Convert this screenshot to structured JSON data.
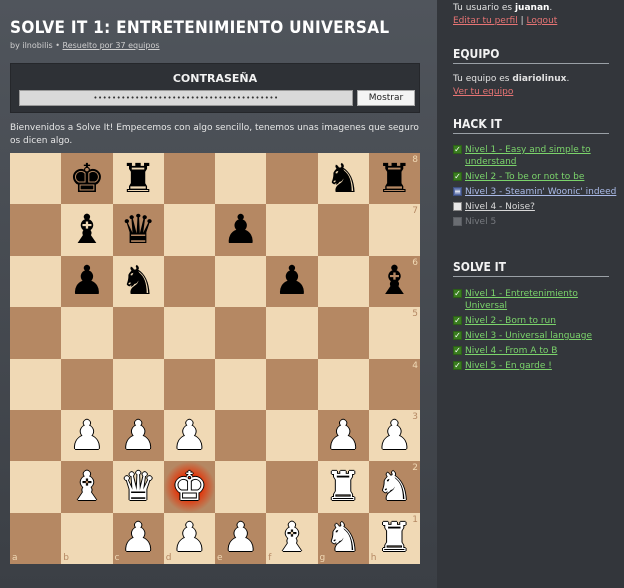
{
  "page": {
    "title": "Solve it 1: Entretenimiento universal",
    "byline_author": "by ilnobilis",
    "byline_sep": " • ",
    "byline_solved": "Resuelto por 37 equipos",
    "password_label": "CONTRASEÑA",
    "password_value": "••••••••••••••••••••••••••••••••••••••••",
    "show_button": "Mostrar",
    "intro": "Bienvenidos a Solve It! Empecemos con algo sencillo, tenemos unas imagenes que seguro os dicen algo."
  },
  "board": {
    "files": [
      "a",
      "b",
      "c",
      "d",
      "e",
      "f",
      "g",
      "h"
    ],
    "ranks": [
      "8",
      "7",
      "6",
      "5",
      "4",
      "3",
      "2",
      "1"
    ],
    "check_square": "d2",
    "pieces": [
      {
        "sq": "b8",
        "glyph": "♚",
        "color": "b"
      },
      {
        "sq": "c8",
        "glyph": "♜",
        "color": "b"
      },
      {
        "sq": "g8",
        "glyph": "♞",
        "color": "b"
      },
      {
        "sq": "h8",
        "glyph": "♜",
        "color": "b"
      },
      {
        "sq": "b7",
        "glyph": "♝",
        "color": "b"
      },
      {
        "sq": "c7",
        "glyph": "♛",
        "color": "b"
      },
      {
        "sq": "e7",
        "glyph": "♟",
        "color": "b"
      },
      {
        "sq": "b6",
        "glyph": "♟",
        "color": "b"
      },
      {
        "sq": "c6",
        "glyph": "♞",
        "color": "b"
      },
      {
        "sq": "f6",
        "glyph": "♟",
        "color": "b"
      },
      {
        "sq": "h6",
        "glyph": "♝",
        "color": "b"
      },
      {
        "sq": "b3",
        "glyph": "♟",
        "color": "w"
      },
      {
        "sq": "c3",
        "glyph": "♟",
        "color": "w"
      },
      {
        "sq": "d3",
        "glyph": "♟",
        "color": "w"
      },
      {
        "sq": "g3",
        "glyph": "♟",
        "color": "w"
      },
      {
        "sq": "h3",
        "glyph": "♟",
        "color": "w"
      },
      {
        "sq": "b2",
        "glyph": "♝",
        "color": "w"
      },
      {
        "sq": "c2",
        "glyph": "♛",
        "color": "w"
      },
      {
        "sq": "d2",
        "glyph": "♚",
        "color": "w"
      },
      {
        "sq": "g2",
        "glyph": "♜",
        "color": "w"
      },
      {
        "sq": "h2",
        "glyph": "♞",
        "color": "w"
      },
      {
        "sq": "c1",
        "glyph": "♟",
        "color": "w"
      },
      {
        "sq": "d1",
        "glyph": "♟",
        "color": "w"
      },
      {
        "sq": "e1",
        "glyph": "♟",
        "color": "w"
      },
      {
        "sq": "f1",
        "glyph": "♝",
        "color": "w"
      },
      {
        "sq": "g1",
        "glyph": "♞",
        "color": "w"
      },
      {
        "sq": "h1",
        "glyph": "♜",
        "color": "w"
      }
    ]
  },
  "sidebar": {
    "user_prefix": "Tu usuario es ",
    "user_name": "juanan",
    "user_suffix": ".",
    "edit_profile": "Editar tu perfil",
    "sep": " | ",
    "logout": "Logout",
    "equipo_heading": "EQUIPO",
    "team_prefix": "Tu equipo es ",
    "team_name": "diariolinux",
    "team_suffix": ".",
    "view_team": "Ver tu equipo",
    "hackit_heading": "HACK IT",
    "hackit_levels": [
      {
        "label": "Nivel 1 - Easy and simple to understand",
        "state": "ok",
        "style": "green"
      },
      {
        "label": "Nivel 2 - To be or not to be",
        "state": "ok",
        "style": "green"
      },
      {
        "label": "Nivel 3 - Steamin' Woonic' indeed",
        "state": "partial",
        "style": "blue"
      },
      {
        "label": "Nivel 4 - Noise?",
        "state": "todo",
        "style": "white"
      },
      {
        "label": "Nivel 5",
        "state": "locked",
        "style": "grey"
      }
    ],
    "solveit_heading": "SOLVE IT",
    "solveit_levels": [
      {
        "label": "Nivel 1 - Entretenimiento Universal",
        "state": "ok",
        "style": "green"
      },
      {
        "label": "Nivel 2 - Born to run",
        "state": "ok",
        "style": "green"
      },
      {
        "label": "Nivel 3 - Universal language",
        "state": "ok",
        "style": "green"
      },
      {
        "label": "Nivel 4 - From A to B",
        "state": "ok",
        "style": "green"
      },
      {
        "label": "Nivel 5 - En garde !",
        "state": "ok",
        "style": "green"
      }
    ]
  }
}
